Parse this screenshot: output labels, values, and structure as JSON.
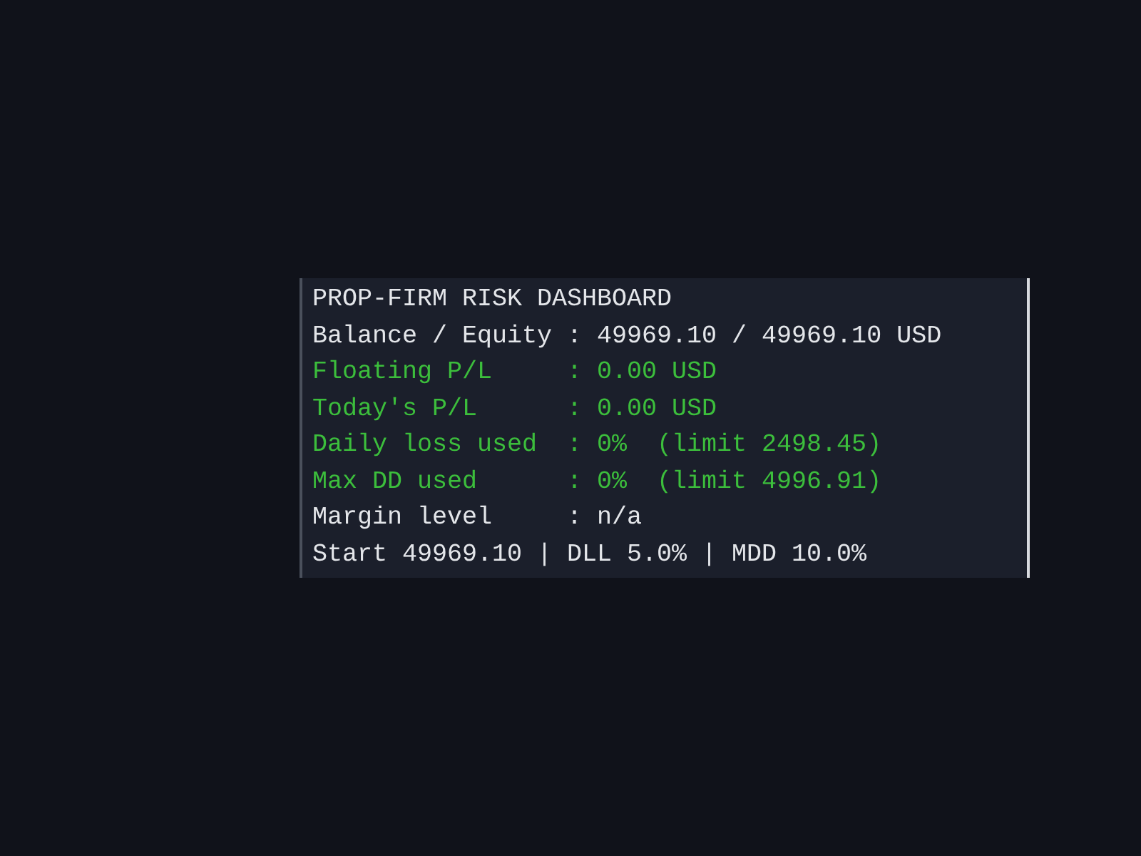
{
  "panel": {
    "lines": [
      {
        "text": "PROP-FIRM RISK DASHBOARD",
        "color": "#e4e6ea"
      },
      {
        "text": "Balance / Equity : 49969.10 / 49969.10 USD",
        "color": "#e4e6ea"
      },
      {
        "text": "Floating P/L     : 0.00 USD",
        "color": "#3cbe3c"
      },
      {
        "text": "Today's P/L      : 0.00 USD",
        "color": "#3cbe3c"
      },
      {
        "text": "Daily loss used  : 0%  (limit 2498.45)",
        "color": "#3cbe3c"
      },
      {
        "text": "Max DD used      : 0%  (limit 4996.91)",
        "color": "#3cbe3c"
      },
      {
        "text": "Margin level     : n/a",
        "color": "#e4e6ea"
      },
      {
        "text": "Start 49969.10 | DLL 5.0% | MDD 10.0%",
        "color": "#e4e6ea"
      }
    ]
  }
}
